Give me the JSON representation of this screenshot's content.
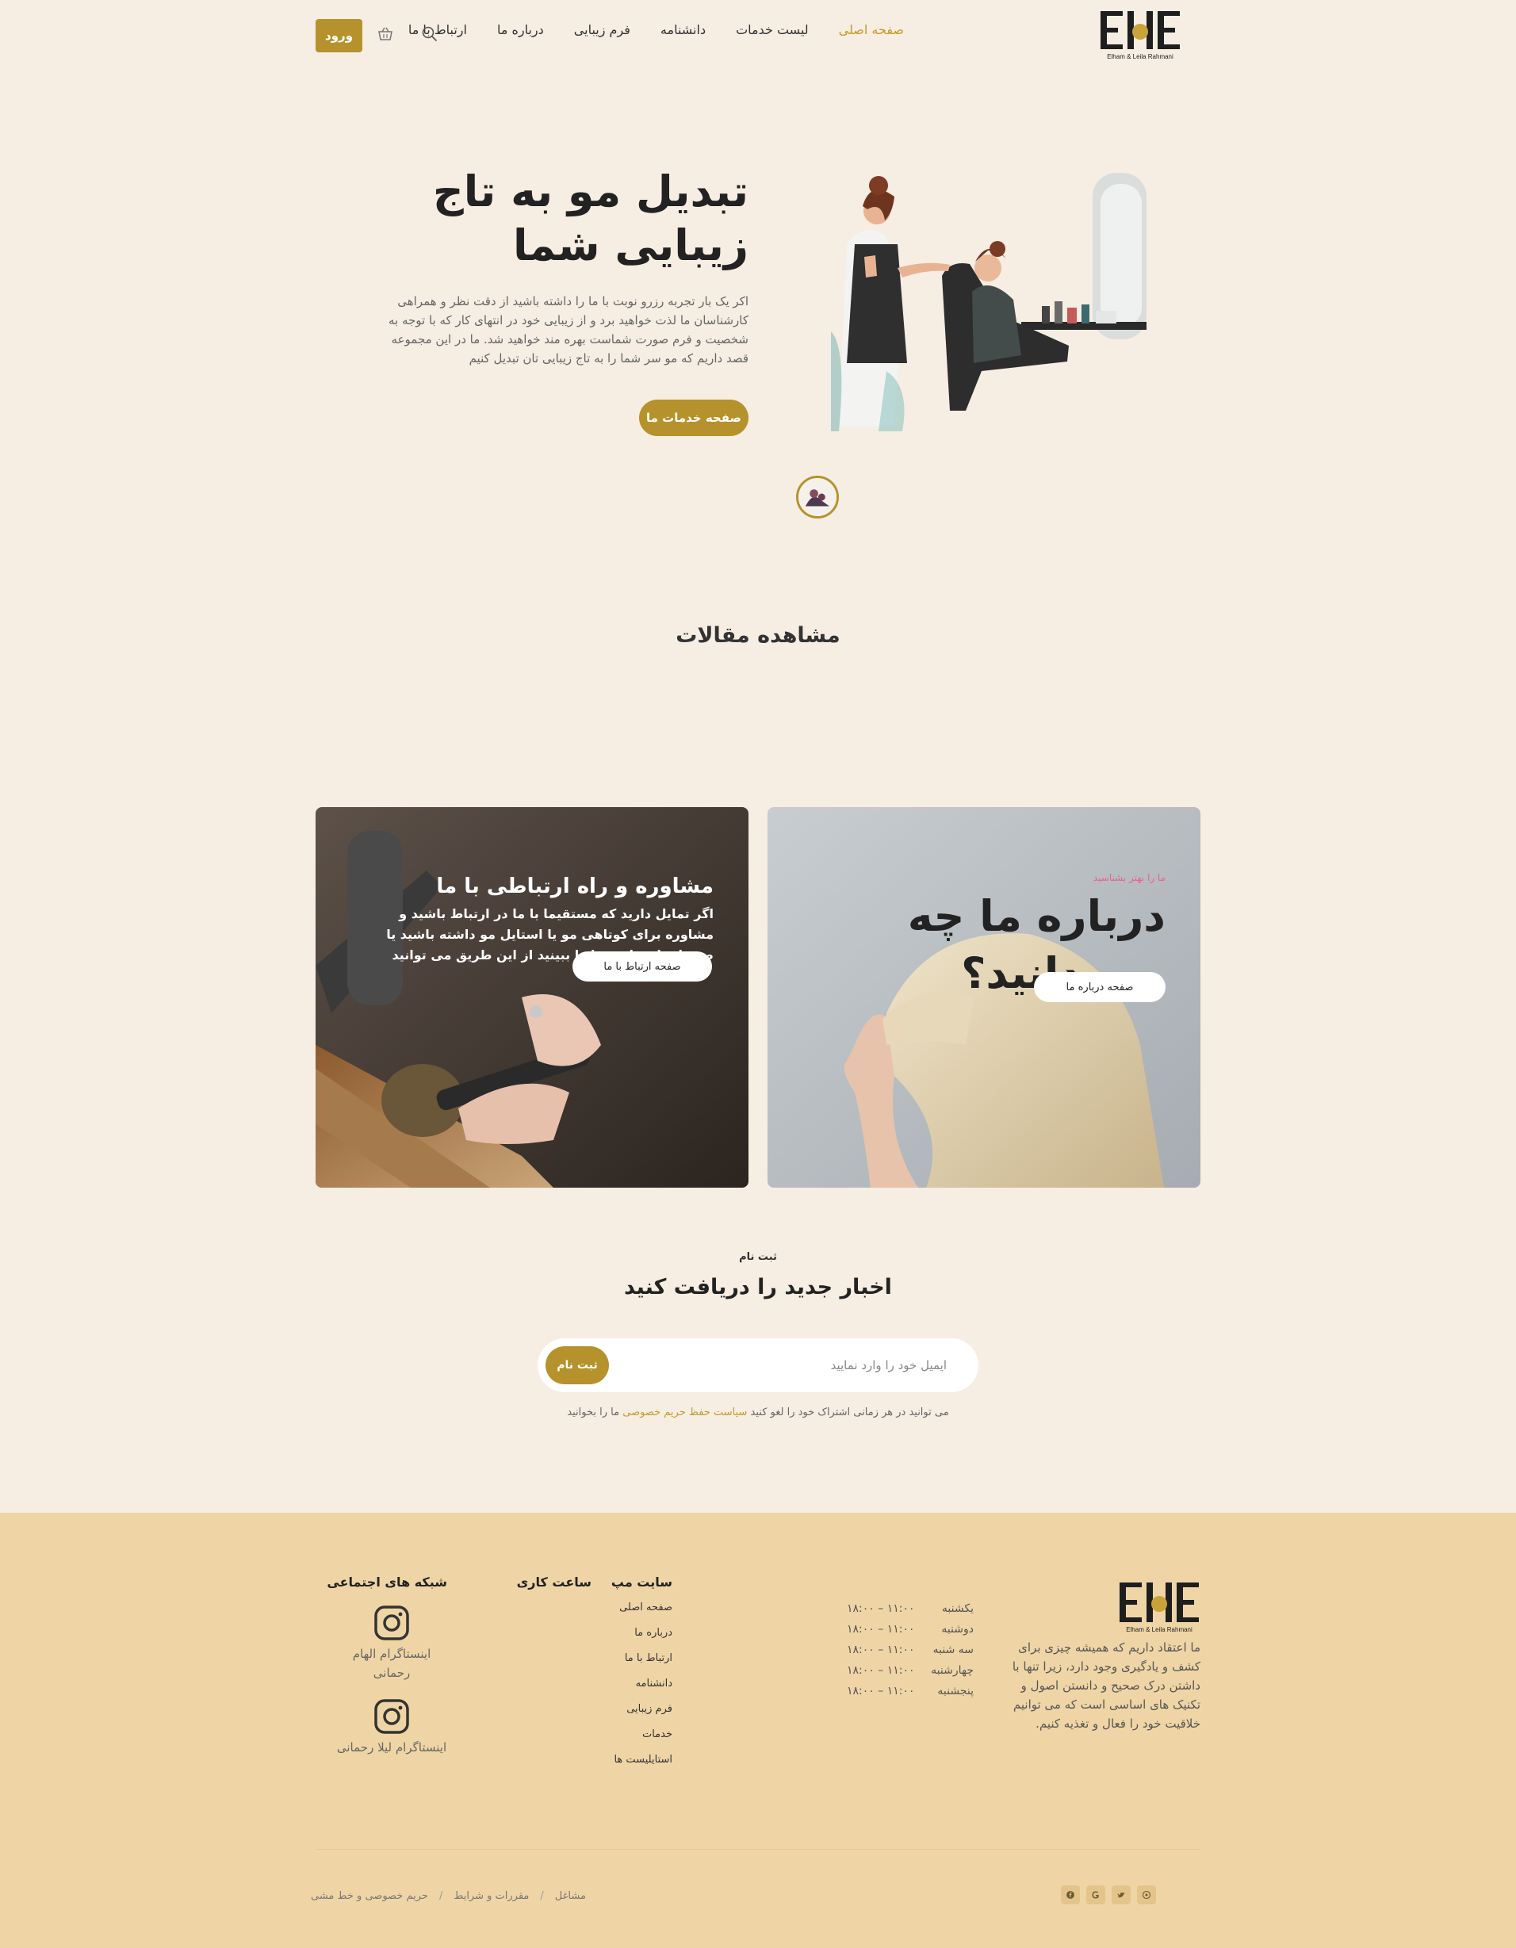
{
  "header": {
    "nav": [
      {
        "label": "صفحه اصلی",
        "active": true
      },
      {
        "label": "لیست خدمات",
        "active": false
      },
      {
        "label": "دانشنامه",
        "active": false
      },
      {
        "label": "فرم زیبایی",
        "active": false
      },
      {
        "label": "درباره ما",
        "active": false
      },
      {
        "label": "ارتباط با ما",
        "active": false
      }
    ],
    "login_label": "ورود",
    "search_icon": "search-icon",
    "cart_icon": "basket-icon",
    "logo_text": "Elham & Leila Rahmani"
  },
  "hero": {
    "title_line1": "تبدیل مو به تاج",
    "title_line2": "زیبایی شما",
    "text": "اکر یک بار تجربه رزرو نوبت با ما را داشته باشید از دقت نظر و همراهی کارشناسان ما لذت خواهید برد و از زیبایی خود در انتهای کار که با توجه به شخصیت و فرم صورت شماست بهره مند خواهید شد. ما در این مجموعه قصد داریم که مو سر شما را به تاج زیبایی تان تبدیل کنیم",
    "button": "صفحه خدمات ما"
  },
  "articles": {
    "title": "مشاهده مقالات"
  },
  "cards": {
    "contact": {
      "title": "مشاوره و راه ارتباطی با ما",
      "text": "اگر تمایل دارید که مستقیما با ما در ارتباط باشید و مشاوره برای کوتاهی مو یا استایل مو داشته باشید یا صفحات اجتماعی ما را ببینید از این طریق می توانید",
      "button": "صفحه ارتباط با ما"
    },
    "about": {
      "subtitle": "ما را بهتر بشناسید",
      "title": "درباره ما چه می دانید؟",
      "button": "صفحه درباره ما"
    }
  },
  "newsletter": {
    "kicker": "ثبت نام",
    "title": "اخبار جدید را دریافت کنید",
    "placeholder": "ایمیل خود را وارد نمایید",
    "button": "ثبت نام",
    "note_before": "می توانید در هر زمانی اشتراک خود را لغو کنید",
    "note_link": "سیاست حفظ حریم خصوصی",
    "note_after": "ما را بخوانید"
  },
  "footer": {
    "about": "ما اعتقاد داریم که همیشه چیزی برای کشف و یادگیری وجود دارد، زیرا تنها با داشتن درک صحیح و دانستن اصول و تکنیک های اساسی است که می توانیم خلاقیت خود را فعال و تغذیه کنیم.",
    "hours_title": "ساعت کاری",
    "hours": [
      {
        "day": "یکشنبه",
        "time": "۱۱:۰۰ – ۱۸:۰۰"
      },
      {
        "day": "دوشنبه",
        "time": "۱۱:۰۰ – ۱۸:۰۰"
      },
      {
        "day": "سه شنبه",
        "time": "۱۱:۰۰ – ۱۸:۰۰"
      },
      {
        "day": "چهارشنبه",
        "time": "۱۱:۰۰ – ۱۸:۰۰"
      },
      {
        "day": "پنجشنبه",
        "time": "۱۱:۰۰ – ۱۸:۰۰"
      }
    ],
    "sitemap_title": "سایت مپ",
    "sitemap": [
      "صفحه اصلی",
      "درباره ما",
      "ارتباط با ما",
      "دانشنامه",
      "فرم زیبایی",
      "خدمات",
      "استایلیست ها"
    ],
    "social_title": "شبکه های اجتماعی",
    "socials": [
      {
        "label": "اینستاگرام الهام رحمانی",
        "icon": "instagram-icon"
      },
      {
        "label": "اینستاگرام لیلا رحمانی",
        "icon": "instagram-icon"
      }
    ],
    "bottom_links": [
      "حریم خصوصی و خط مشی",
      "مقررات و شرایط",
      "مشاغل"
    ],
    "bottom_social_icons": [
      "facebook-icon",
      "google-icon",
      "twitter-icon",
      "github-icon"
    ]
  },
  "colors": {
    "accent": "#b5922b",
    "background": "#f6ede3",
    "footer": "#efd5a5",
    "link": "#c49a2a",
    "pink_kicker": "#e8648a"
  }
}
